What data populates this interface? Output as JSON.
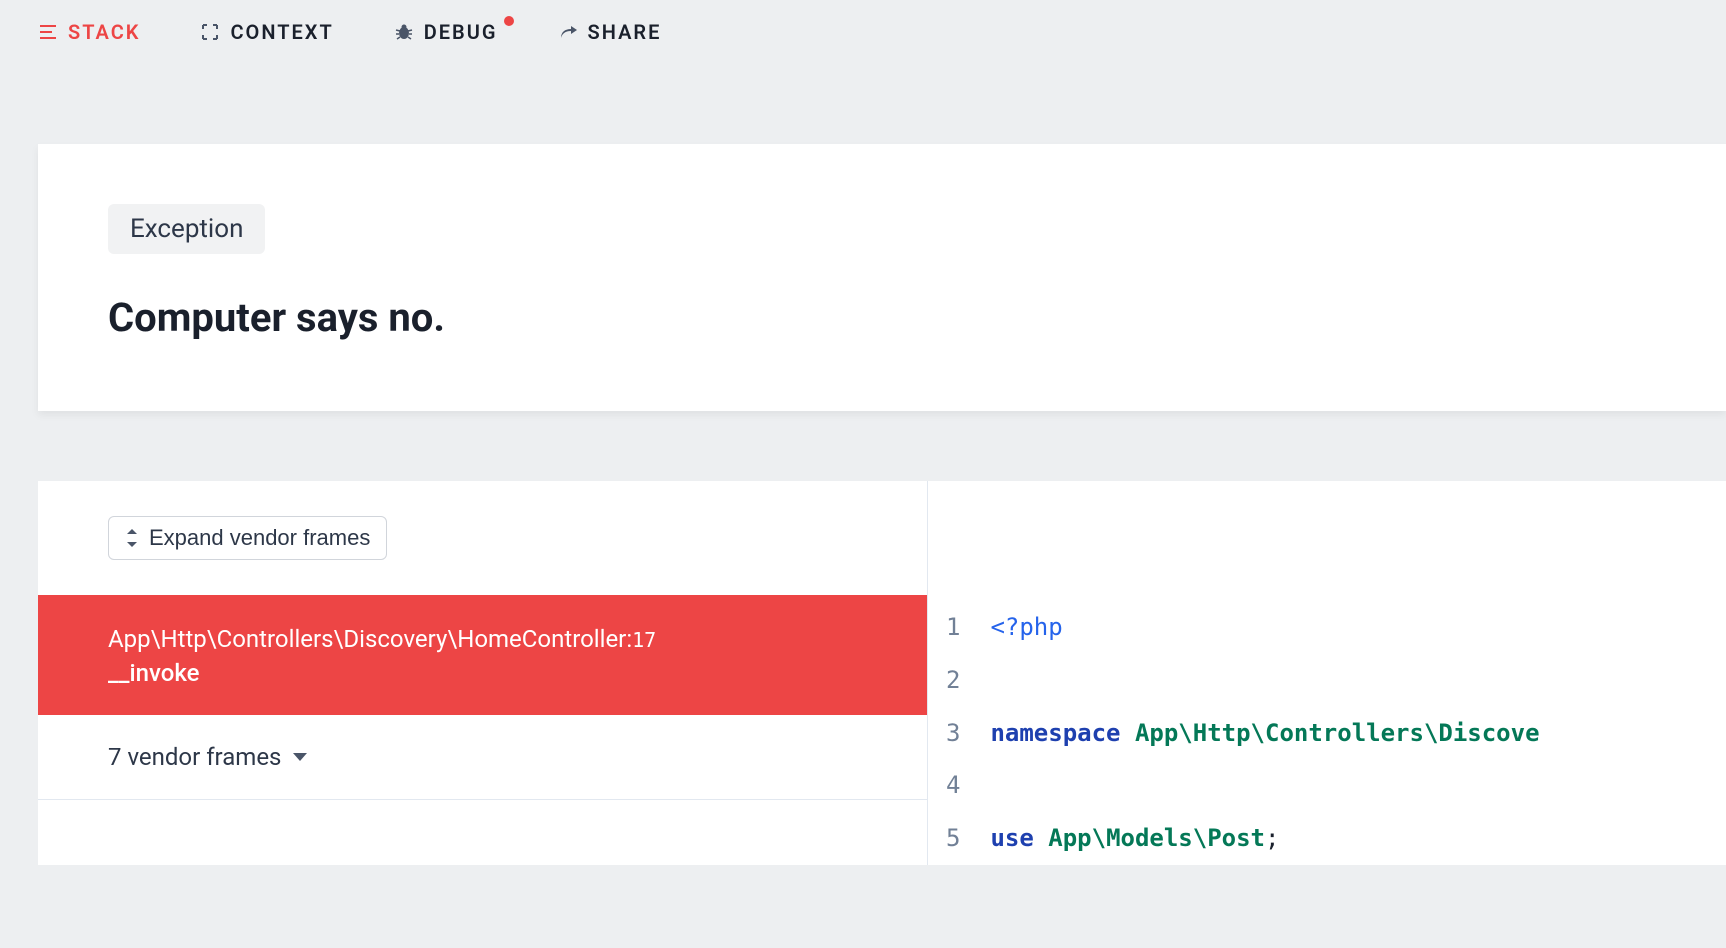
{
  "nav": {
    "stack": "STACK",
    "context": "CONTEXT",
    "debug": "DEBUG",
    "share": "SHARE"
  },
  "exception": {
    "badge": "Exception",
    "message": "Computer says no."
  },
  "frames": {
    "expand_label": "Expand vendor frames",
    "active": {
      "path": "App\\Http\\Controllers\\Discovery\\HomeController",
      "line": "17",
      "method": "__invoke"
    },
    "vendor_collapsed": "7 vendor frames"
  },
  "code": {
    "lines": [
      {
        "n": "1",
        "tokens": [
          {
            "t": "<?php",
            "c": "tok-tag"
          }
        ]
      },
      {
        "n": "2",
        "tokens": []
      },
      {
        "n": "3",
        "tokens": [
          {
            "t": "namespace",
            "c": "tok-keyword"
          },
          {
            "t": " ",
            "c": ""
          },
          {
            "t": "App\\Http\\Controllers\\Discove",
            "c": "tok-namespace"
          }
        ]
      },
      {
        "n": "4",
        "tokens": []
      },
      {
        "n": "5",
        "tokens": [
          {
            "t": "use",
            "c": "tok-keyword"
          },
          {
            "t": " ",
            "c": ""
          },
          {
            "t": "App\\Models\\Post",
            "c": "tok-namespace"
          },
          {
            "t": ";",
            "c": "tok-punct"
          }
        ]
      }
    ]
  }
}
